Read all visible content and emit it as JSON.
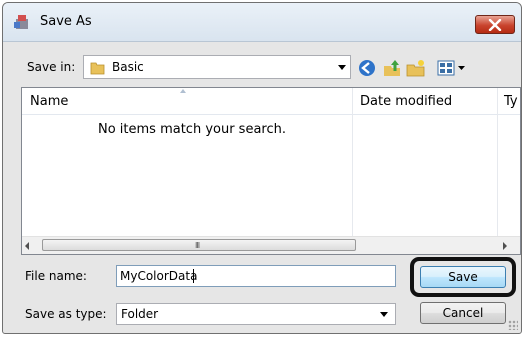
{
  "window": {
    "title": "Save As"
  },
  "toolbar": {
    "save_in_label": "Save in:",
    "save_in_value": "Basic"
  },
  "filelist": {
    "columns": [
      "Name",
      "Date modified",
      "Ty"
    ],
    "empty_message": "No items match your search.",
    "scroll_grip": "III"
  },
  "form": {
    "filename_label": "File name:",
    "filename_value": "MyColorData",
    "savetype_label": "Save as type:",
    "savetype_value": "Folder"
  },
  "buttons": {
    "save": "Save",
    "cancel": "Cancel"
  },
  "colors": {
    "accent": "#3c7fb1",
    "close": "#c9442e",
    "highlight_ring": "#111111"
  },
  "icons": [
    "save-as-app-icon",
    "close-icon",
    "folder-icon",
    "back-icon",
    "up-folder-icon",
    "new-folder-icon",
    "view-menu-icon"
  ]
}
